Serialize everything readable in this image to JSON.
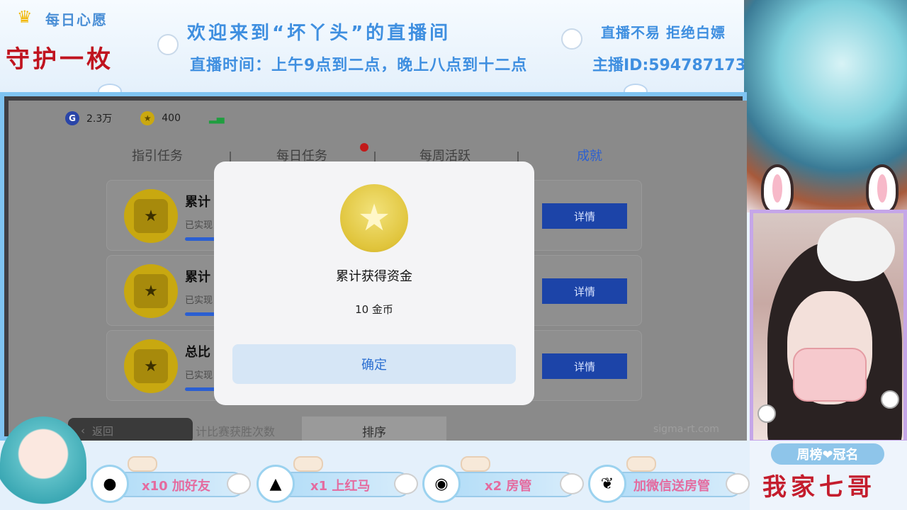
{
  "overlay": {
    "crown_icon": "crown-icon",
    "daily_wish": "每日心愿",
    "guard_text": "守护一枚",
    "welcome": "欢迎来到“坏丫头”的直播间",
    "hours": "直播时间：上午9点到二点，晚上八点到十二点",
    "slogan": "直播不易 拒绝白嫖",
    "host_id": "主播ID:594787173"
  },
  "game": {
    "resources": {
      "g_icon": "G",
      "g_value": "2.3万",
      "star_value": "400",
      "signal_icon": "signal-icon"
    },
    "tabs": [
      {
        "label": "指引任务",
        "active": false
      },
      {
        "label": "每日任务",
        "active": false
      },
      {
        "label": "每周活跃",
        "active": false
      },
      {
        "label": "成就",
        "active": true
      }
    ],
    "tasks": [
      {
        "title": "累计",
        "sub": "已实现",
        "button": "详情"
      },
      {
        "title": "累计",
        "sub": "已实现",
        "button": "详情"
      },
      {
        "title": "总比",
        "sub": "已实现",
        "button": "详情"
      }
    ],
    "back_label": "返回",
    "hint_text": "计比赛获胜次数",
    "sort_label": "排序",
    "watermark": "sigma-rt.com",
    "modal": {
      "title": "累计获得资金",
      "amount": "10 金币",
      "confirm": "确定"
    }
  },
  "gift_bar": {
    "items": [
      {
        "text": "x10 加好友"
      },
      {
        "text": "x1 上红马"
      },
      {
        "text": "x2 房管"
      },
      {
        "text": "加微信送房管"
      }
    ]
  },
  "rank": {
    "title": "周榜❤冠名",
    "name": "我家七哥"
  },
  "colors": {
    "accent_blue": "#3f8fe0",
    "frame_blue": "#7fc4f2",
    "guard_red": "#c0141f",
    "detail_button": "#1c44a8"
  }
}
